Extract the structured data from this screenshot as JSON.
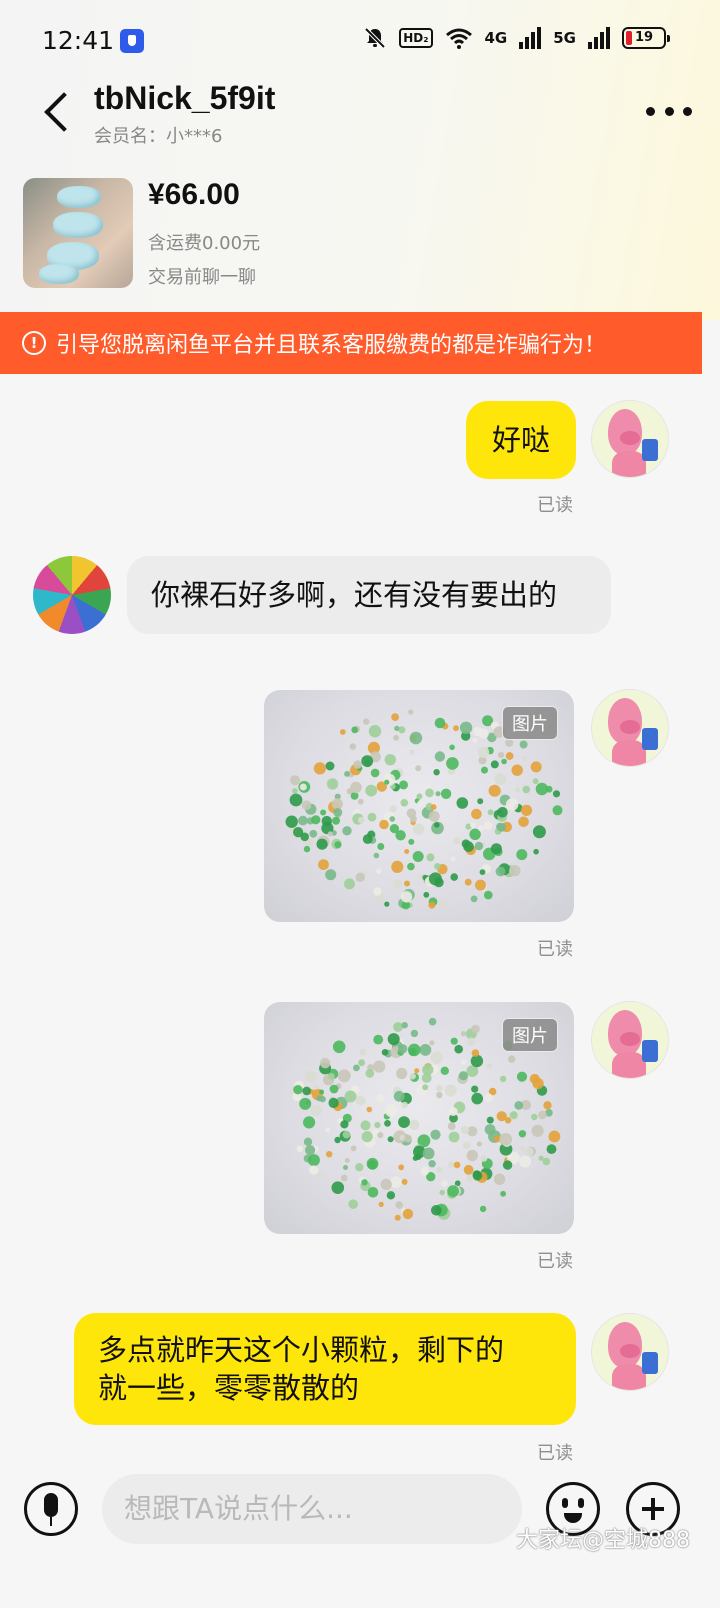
{
  "status_bar": {
    "time": "12:41",
    "hd_label": "HD₂",
    "net4g_label": "4G",
    "net5g_label": "5G",
    "battery": "19"
  },
  "header": {
    "title": "tbNick_5f9it",
    "subtitle": "会员名：小***6"
  },
  "product": {
    "price": "¥66.00",
    "shipping": "含运费0.00元",
    "note": "交易前聊一聊"
  },
  "warning": {
    "icon": "!",
    "text": "引导您脱离闲鱼平台并且联系客服缴费的都是诈骗行为！"
  },
  "messages": {
    "m1": {
      "text": "好哒",
      "status": "已读"
    },
    "m2": {
      "text": "你裸石好多啊，还有没有要出的"
    },
    "m3": {
      "badge": "图片",
      "status": "已读"
    },
    "m4": {
      "badge": "图片",
      "status": "已读"
    },
    "m5": {
      "line1": "多点就昨天这个小颗粒，剩下的",
      "line2": "就一些，零零散散的",
      "status": "已读"
    }
  },
  "input": {
    "placeholder": "想跟TA说点什么..."
  },
  "watermark": "大家坛@空城888",
  "colors": {
    "my_bubble": "#ffe60a",
    "warning_banner": "#ff5b2b",
    "other_bubble": "#ececec"
  }
}
